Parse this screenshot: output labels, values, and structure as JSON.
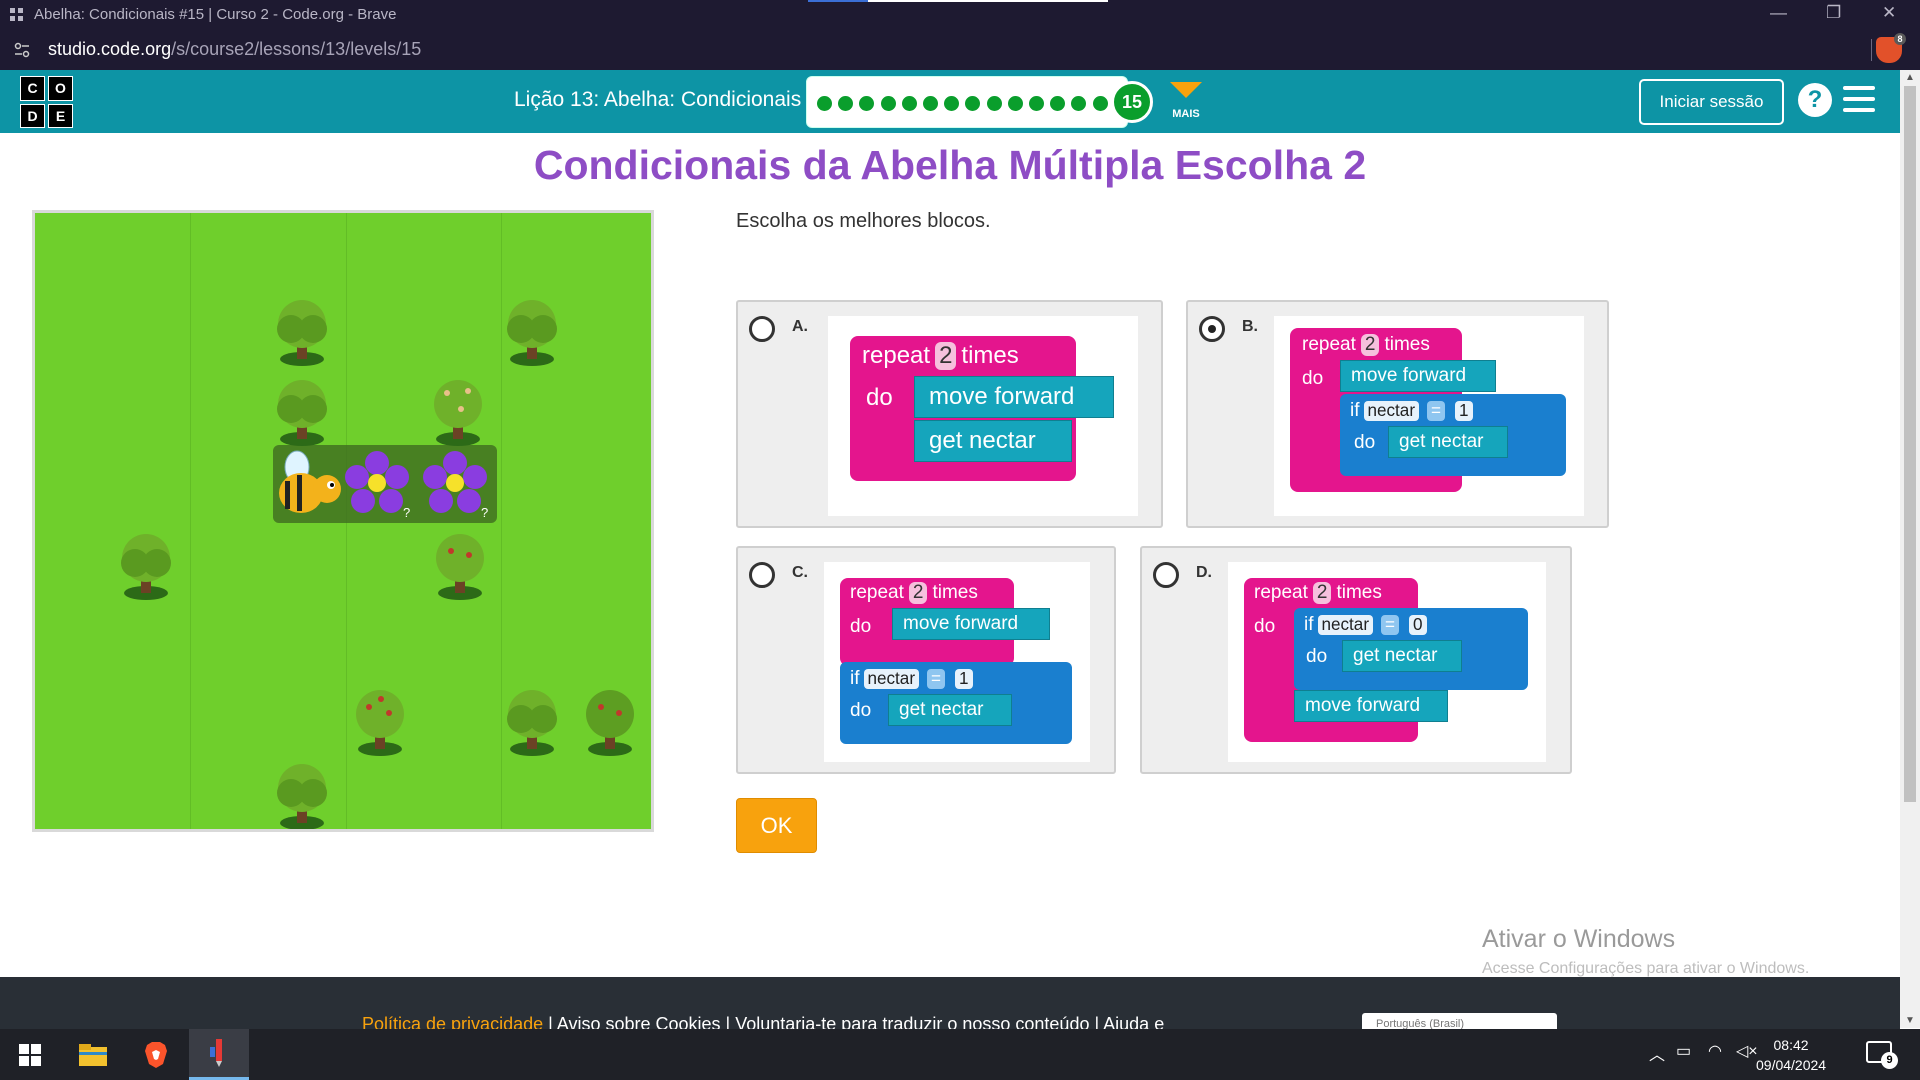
{
  "window": {
    "title": "Abelha: Condicionais #15 | Curso 2 - Code.org - Brave"
  },
  "address": {
    "host": "studio.code.org",
    "path": "/s/course2/lessons/13/levels/15",
    "ext_badge": "8"
  },
  "header": {
    "logo_letters": [
      "C",
      "O",
      "D",
      "E"
    ],
    "lesson": "Lição 13: Abelha: Condicionais",
    "level_number": "15",
    "completed_dots": 14,
    "more_label": "MAIS",
    "signin": "Iniciar sessão",
    "help": "?"
  },
  "puzzle": {
    "title": "Condicionais da Abelha Múltipla Escolha 2",
    "instruction": "Escolha os melhores blocos.",
    "selected_option": "B",
    "options": [
      {
        "letter": "A.",
        "lines": [
          "repeat",
          "2",
          "times",
          "do",
          "move forward",
          "get nectar"
        ]
      },
      {
        "letter": "B.",
        "lines": [
          "repeat",
          "2",
          "times",
          "do",
          "move forward",
          "if",
          "nectar",
          "=",
          "1",
          "do",
          "get nectar"
        ]
      },
      {
        "letter": "C.",
        "lines": [
          "repeat",
          "2",
          "times",
          "do",
          "move forward",
          "if",
          "nectar",
          "=",
          "1",
          "do",
          "get nectar"
        ]
      },
      {
        "letter": "D.",
        "lines": [
          "repeat",
          "2",
          "times",
          "do",
          "if",
          "nectar",
          "=",
          "0",
          "do",
          "get nectar",
          "move forward"
        ]
      }
    ],
    "ok": "OK"
  },
  "watermark": {
    "line1": "Ativar o Windows",
    "line2": "Acesse Configurações para ativar o Windows."
  },
  "footer": {
    "privacy": "Política de privacidade",
    "sep": " | ",
    "cookies": "Aviso sobre Cookies",
    "translate": "Voluntaria-te para traduzir o nosso conteúdo",
    "help": "Ajuda e",
    "language": "Português (Brasil)"
  },
  "taskbar": {
    "time": "08:42",
    "date": "09/04/2024",
    "notif_count": "9"
  },
  "colors": {
    "teal": "#0d94a5",
    "purple_title": "#8e4dc5",
    "ok_orange": "#f8a20d",
    "repeat_pink": "#e4158d",
    "action_cyan": "#15a5bc",
    "if_blue": "#1a7fcf"
  }
}
